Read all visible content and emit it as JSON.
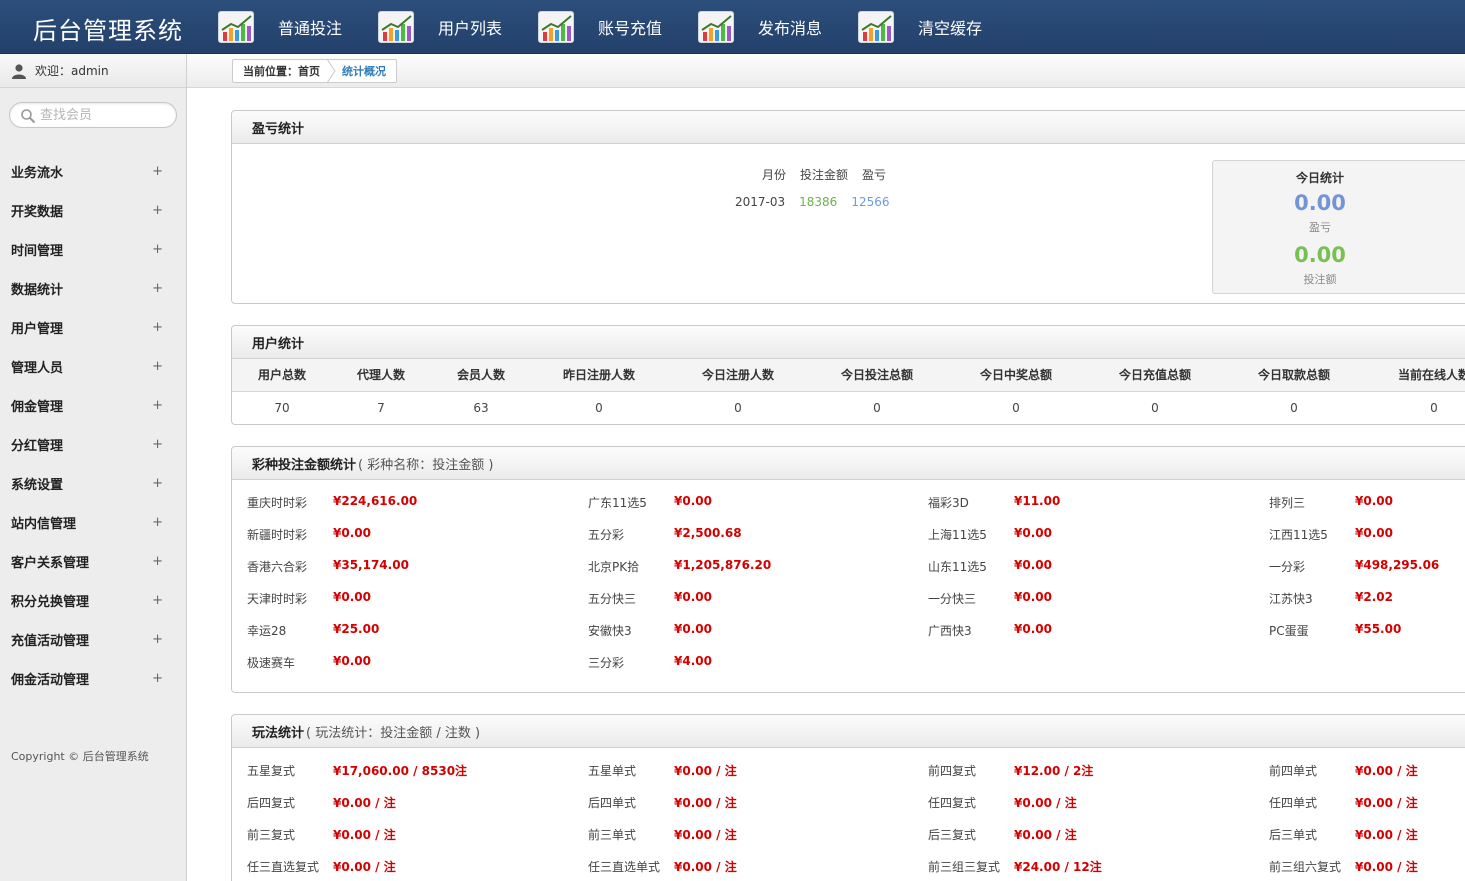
{
  "app": {
    "title": "后台管理系统"
  },
  "nav": [
    {
      "label": "普通投注"
    },
    {
      "label": "用户列表"
    },
    {
      "label": "账号充值"
    },
    {
      "label": "发布消息"
    },
    {
      "label": "清空缓存"
    }
  ],
  "sidebar": {
    "welcome": "欢迎：admin",
    "search_placeholder": "查找会员",
    "items": [
      {
        "label": "业务流水"
      },
      {
        "label": "开奖数据"
      },
      {
        "label": "时间管理"
      },
      {
        "label": "数据统计"
      },
      {
        "label": "用户管理"
      },
      {
        "label": "管理人员"
      },
      {
        "label": "佣金管理"
      },
      {
        "label": "分红管理"
      },
      {
        "label": "系统设置"
      },
      {
        "label": "站内信管理"
      },
      {
        "label": "客户关系管理"
      },
      {
        "label": "积分兑换管理"
      },
      {
        "label": "充值活动管理"
      },
      {
        "label": "佣金活动管理"
      }
    ],
    "expand_symbol": "+",
    "copyright": "Copyright © 后台管理系统"
  },
  "breadcrumb": {
    "prefix": "当前位置：首页",
    "current": "统计概况"
  },
  "profit": {
    "title": "盈亏统计",
    "headers": [
      "月份",
      "投注金额",
      "盈亏"
    ],
    "row": {
      "month": "2017-03",
      "bet": "18386",
      "pl": "12566"
    },
    "today": {
      "title": "今日统计",
      "pl_value": "0.00",
      "pl_label": "盈亏",
      "bet_value": "0.00",
      "bet_label": "投注额"
    }
  },
  "users": {
    "title": "用户统计",
    "headers": [
      "用户总数",
      "代理人数",
      "会员人数",
      "昨日注册人数",
      "今日注册人数",
      "今日投注总额",
      "今日中奖总额",
      "今日充值总额",
      "今日取款总额",
      "当前在线人数"
    ],
    "values": [
      "70",
      "7",
      "63",
      "0",
      "0",
      "0",
      "0",
      "0",
      "0",
      "0"
    ]
  },
  "lottery": {
    "title": "彩种投注金额统计",
    "subtitle": "( 彩种名称：投注金额 )",
    "items": [
      {
        "name": "重庆时时彩",
        "value": "¥224,616.00"
      },
      {
        "name": "广东11选5",
        "value": "¥0.00"
      },
      {
        "name": "福彩3D",
        "value": "¥11.00"
      },
      {
        "name": "排列三",
        "value": "¥0.00"
      },
      {
        "name": "新疆时时彩",
        "value": "¥0.00"
      },
      {
        "name": "五分彩",
        "value": "¥2,500.68"
      },
      {
        "name": "上海11选5",
        "value": "¥0.00"
      },
      {
        "name": "江西11选5",
        "value": "¥0.00"
      },
      {
        "name": "香港六合彩",
        "value": "¥35,174.00"
      },
      {
        "name": "北京PK拾",
        "value": "¥1,205,876.20"
      },
      {
        "name": "山东11选5",
        "value": "¥0.00"
      },
      {
        "name": "一分彩",
        "value": "¥498,295.06"
      },
      {
        "name": "天津时时彩",
        "value": "¥0.00"
      },
      {
        "name": "五分快三",
        "value": "¥0.00"
      },
      {
        "name": "一分快三",
        "value": "¥0.00"
      },
      {
        "name": "江苏快3",
        "value": "¥2.02"
      },
      {
        "name": "幸运28",
        "value": "¥25.00"
      },
      {
        "name": "安徽快3",
        "value": "¥0.00"
      },
      {
        "name": "广西快3",
        "value": "¥0.00"
      },
      {
        "name": "PC蛋蛋",
        "value": "¥55.00"
      },
      {
        "name": "极速赛车",
        "value": "¥0.00"
      },
      {
        "name": "三分彩",
        "value": "¥4.00"
      }
    ]
  },
  "plays": {
    "title": "玩法统计",
    "subtitle": "( 玩法统计：投注金额 / 注数 )",
    "items": [
      {
        "name": "五星复式",
        "value": "¥17,060.00 / 8530注"
      },
      {
        "name": "五星单式",
        "value": "¥0.00 / 注"
      },
      {
        "name": "前四复式",
        "value": "¥12.00 / 2注"
      },
      {
        "name": "前四单式",
        "value": "¥0.00 / 注"
      },
      {
        "name": "后四复式",
        "value": "¥0.00 / 注"
      },
      {
        "name": "后四单式",
        "value": "¥0.00 / 注"
      },
      {
        "name": "任四复式",
        "value": "¥0.00 / 注"
      },
      {
        "name": "任四单式",
        "value": "¥0.00 / 注"
      },
      {
        "name": "前三复式",
        "value": "¥0.00 / 注"
      },
      {
        "name": "前三单式",
        "value": "¥0.00 / 注"
      },
      {
        "name": "后三复式",
        "value": "¥0.00 / 注"
      },
      {
        "name": "后三单式",
        "value": "¥0.00 / 注"
      },
      {
        "name": "任三直选复式",
        "value": "¥0.00 / 注"
      },
      {
        "name": "任三直选单式",
        "value": "¥0.00 / 注"
      },
      {
        "name": "前三组三复式",
        "value": "¥24.00 / 12注"
      },
      {
        "name": "前三组六复式",
        "value": "¥0.00 / 注"
      }
    ]
  },
  "colors": {
    "header_bg": "#2d4f7c",
    "value_red": "#d40000",
    "blue": "#7394d6",
    "green": "#79c052"
  },
  "icons": {
    "nav": "chart-icon",
    "user": "user-icon",
    "search": "search-icon"
  }
}
